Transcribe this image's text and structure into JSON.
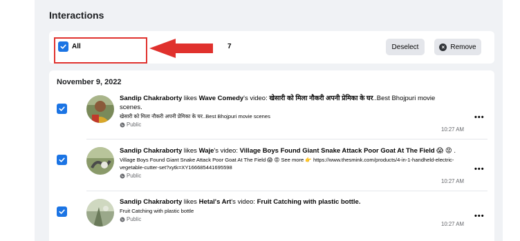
{
  "section": {
    "title": "Interactions"
  },
  "toolbar": {
    "select_all_label": "All",
    "selected_count": "7",
    "deselect_label": "Deselect",
    "remove_label": "Remove",
    "select_all_checked": true
  },
  "group": {
    "date": "November 9, 2022"
  },
  "colors": {
    "accent": "#1b74e4",
    "annotation_red": "#e0312d",
    "panel_bg": "#f0f2f5"
  },
  "items": [
    {
      "checked": true,
      "actor": "Sandip Chakraborty",
      "verb": " likes ",
      "page": "Wave Comedy",
      "possessive": "'s video: ",
      "video_title": "खेसारी को मिला नौकरी अपनी प्रेमिका के घर",
      "title_rest": "..Best Bhojpuri movie scenes.",
      "description": "खेसारी को मिला नौकरी अपनी प्रेमिका के घर..Best Bhojpuri movie scenes",
      "privacy": "Public",
      "time": "10:27 AM",
      "more": "•••"
    },
    {
      "checked": true,
      "actor": "Sandip Chakraborty",
      "verb": " likes ",
      "page": "Waje",
      "possessive": "'s video: ",
      "video_title": "Village Boys Found Giant Snake Attack Poor Goat At The Field",
      "title_rest": " 😱 😡 .",
      "description": "Village Boys Found Giant Snake Attack Poor Goat At The Field 😱 😡 See more 👉 https://www.thesmink.com/products/4-in-1-handheld-electric-vegetable-cutter-set?xytk=XY166685441695598",
      "privacy": "Public",
      "time": "10:27 AM",
      "more": "•••"
    },
    {
      "checked": true,
      "actor": "Sandip Chakraborty",
      "verb": " likes ",
      "page": "Hetal's Art",
      "possessive": "'s video: ",
      "video_title": "Fruit Catching with plastic bottle.",
      "title_rest": "",
      "description": "Fruit Catching with plastic bottle",
      "privacy": "Public",
      "time": "10:27 AM",
      "more": "•••"
    }
  ]
}
